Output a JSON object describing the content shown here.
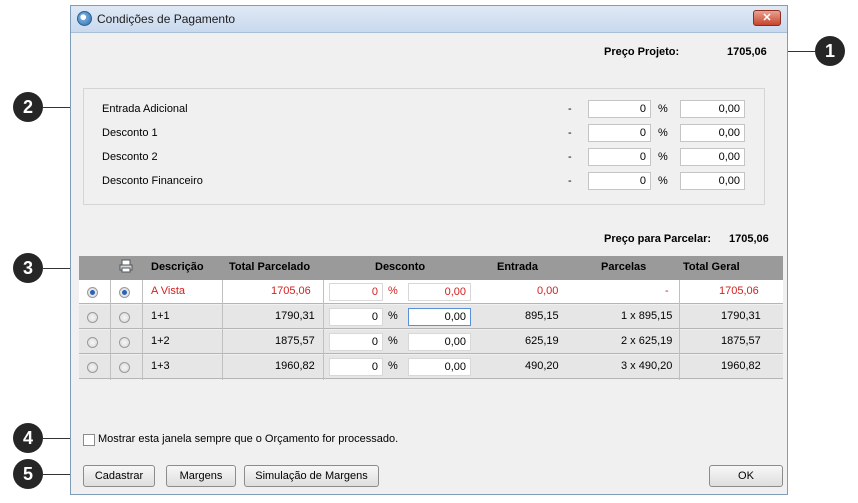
{
  "window": {
    "title": "Condições de Pagamento",
    "close": "✕"
  },
  "preco_projeto": {
    "label": "Preço Projeto:",
    "value": "1705,06"
  },
  "adjustments": [
    {
      "label": "Entrada Adicional",
      "dash": "-",
      "percent": "0",
      "pct_sign": "%",
      "amount": "0,00"
    },
    {
      "label": "Desconto 1",
      "dash": "-",
      "percent": "0",
      "pct_sign": "%",
      "amount": "0,00"
    },
    {
      "label": "Desconto 2",
      "dash": "-",
      "percent": "0",
      "pct_sign": "%",
      "amount": "0,00"
    },
    {
      "label": "Desconto Financeiro",
      "dash": "-",
      "percent": "0",
      "pct_sign": "%",
      "amount": "0,00"
    }
  ],
  "preco_parcelar": {
    "label": "Preço para Parcelar:",
    "value": "1705,06"
  },
  "table": {
    "headers": {
      "descricao": "Descrição",
      "total_parcelado": "Total Parcelado",
      "desconto": "Desconto",
      "entrada": "Entrada",
      "parcelas": "Parcelas",
      "total_geral": "Total Geral"
    },
    "rows": [
      {
        "descricao": "A Vista",
        "total_parcelado": "1705,06",
        "desc_pct": "0",
        "pct_sign": "%",
        "desc_val": "0,00",
        "entrada": "0,00",
        "parcelas": "-",
        "total_geral": "1705,06",
        "selected": true
      },
      {
        "descricao": "1+1",
        "total_parcelado": "1790,31",
        "desc_pct": "0",
        "pct_sign": "%",
        "desc_val": "0,00",
        "entrada": "895,15",
        "parcelas": "1 x 895,15",
        "total_geral": "1790,31",
        "selected": false
      },
      {
        "descricao": "1+2",
        "total_parcelado": "1875,57",
        "desc_pct": "0",
        "pct_sign": "%",
        "desc_val": "0,00",
        "entrada": "625,19",
        "parcelas": "2 x 625,19",
        "total_geral": "1875,57",
        "selected": false
      },
      {
        "descricao": "1+3",
        "total_parcelado": "1960,82",
        "desc_pct": "0",
        "pct_sign": "%",
        "desc_val": "0,00",
        "entrada": "490,20",
        "parcelas": "3 x 490,20",
        "total_geral": "1960,82",
        "selected": false
      }
    ]
  },
  "checkbox_label": "Mostrar esta janela sempre que o Orçamento for processado.",
  "buttons": {
    "cadastrar": "Cadastrar",
    "margens": "Margens",
    "simulacao": "Simulação de Margens",
    "ok": "OK"
  },
  "callouts": [
    "1",
    "2",
    "3",
    "4",
    "5"
  ]
}
